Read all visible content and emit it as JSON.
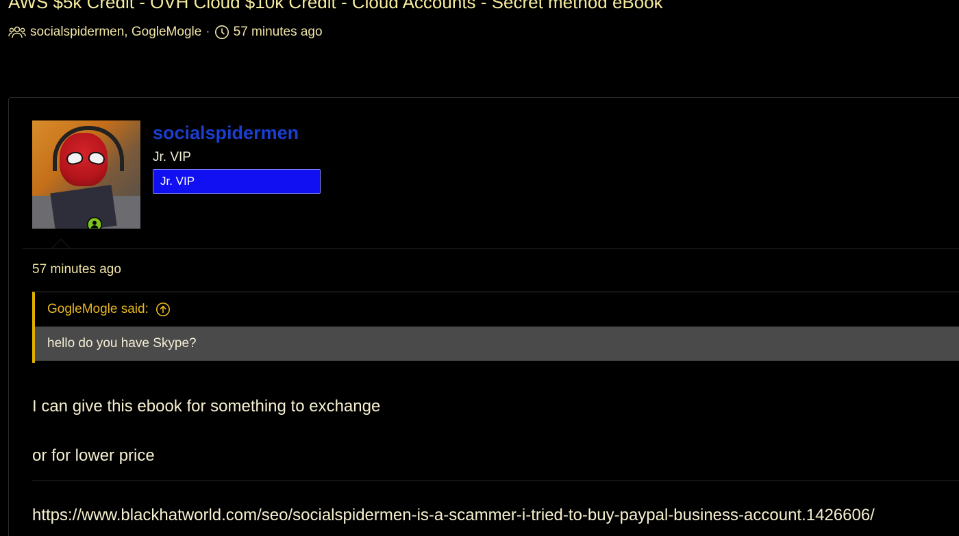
{
  "thread": {
    "title": "AWS $5k Credit - OVH Cloud $10k Credit - Cloud Accounts - Secret method eBook",
    "participants": "socialspidermen, GogleMogle",
    "separator": "·",
    "time_ago": "57 minutes ago"
  },
  "post": {
    "author": {
      "username": "socialspidermen",
      "username_color": "#1a3fd1",
      "user_title": "Jr. VIP",
      "banner_label": "Jr. VIP",
      "banner_color": "#1010f2",
      "status": "online",
      "online_color": "#7fc31c"
    },
    "time_ago": "57 minutes ago",
    "quote": {
      "attribution": "GogleMogle said:",
      "text": "hello do you have Skype?",
      "accent_color": "#e0b000"
    },
    "message_lines": [
      "I can give this ebook for something to exchange",
      "or for lower price"
    ],
    "link": "https://www.blackhatworld.com/seo/socialspidermen-is-a-scammer-i-tried-to-buy-paypal-business-account.1426606/"
  },
  "icons": {
    "participants": "users-icon",
    "time": "clock-icon",
    "quote_jump": "arrow-up-circle-icon",
    "online": "user-online-icon"
  }
}
